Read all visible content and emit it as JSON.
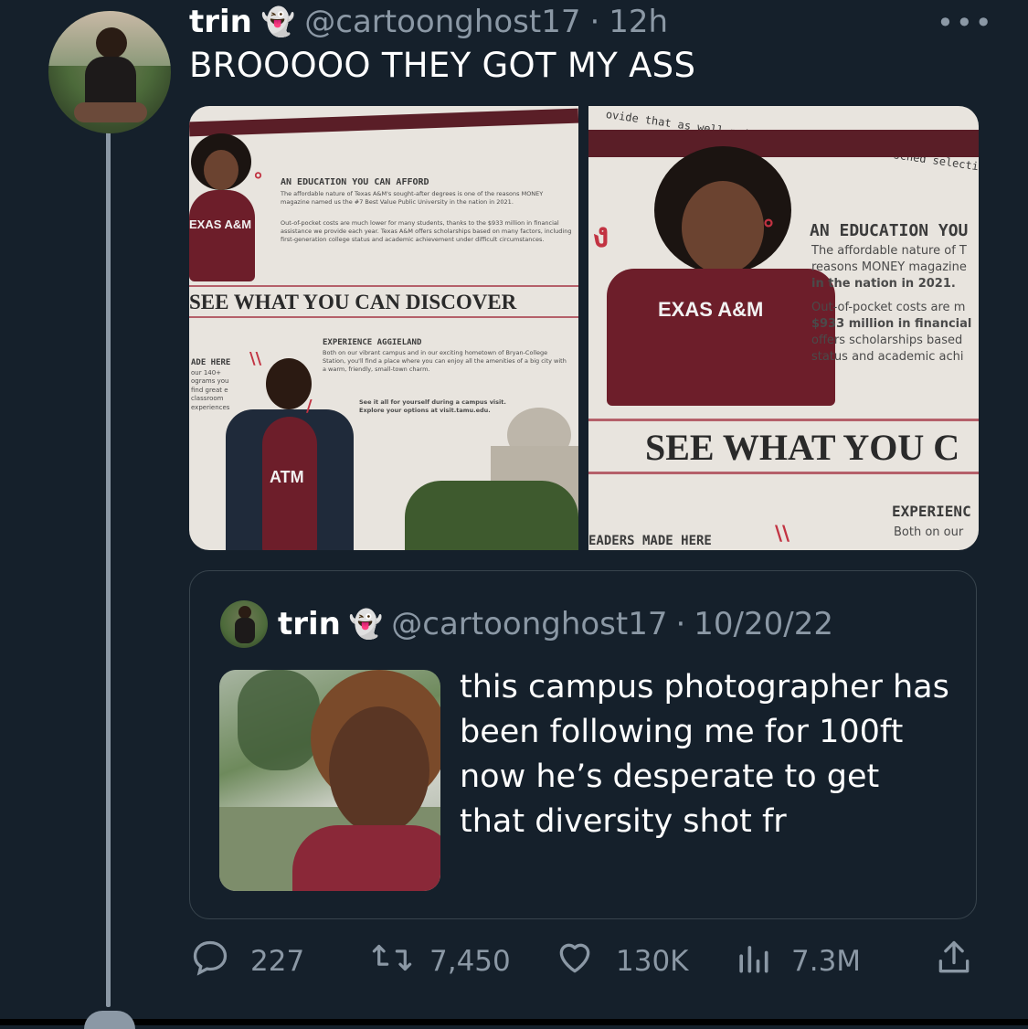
{
  "tweet": {
    "name": "trin",
    "name_emoji": "👻",
    "handle": "@cartoonghost17",
    "separator": "·",
    "time": "12h",
    "text": "BROOOOO THEY GOT MY ASS",
    "more_icon": "more-icon"
  },
  "photos": {
    "left": {
      "heading": "AN EDUCATION YOU CAN AFFORD",
      "body_1": "The affordable nature of Texas A&M's sought-after degrees is one of the reasons MONEY magazine named us the #7 Best Value Public University in the nation in 2021.",
      "body_2": "Out-of-pocket costs are much lower for many students, thanks to the $933 million in financial assistance we provide each year. Texas A&M offers scholarships based on many factors, including first-generation college status and academic achievement under difficult circumstances.",
      "banner": "SEE WHAT YOU CAN DISCOVER",
      "sub_heading": "EXPERIENCE AGGIELAND",
      "sub_body": "Both on our vibrant campus and in our exciting hometown of Bryan-College Station, you'll find a place where you can enjoy all the amenities of a big city with a warm, friendly, small-town charm.",
      "cta": "See it all for yourself during a campus visit. Explore your options at visit.tamu.edu.",
      "side_heading": "ADE HERE",
      "side_body": "our 140+ ograms you find great e classroom experiences",
      "shirt": "EXAS A&M",
      "shirt2": "ATM"
    },
    "right": {
      "heading": "AN EDUCATION YOU CAN",
      "body_1": "The affordable nature of T",
      "body_2": "reasons MONEY magazine",
      "body_3": "in the nation in 2021.",
      "body_4": "Out-of-pocket costs are m",
      "body_5": "$933 million in financial",
      "body_6": "offers scholarships based",
      "body_7": "status and academic achi",
      "banner": "SEE WHAT YOU C",
      "sub_heading": "EXPERIENC",
      "sub_body": "Both on our",
      "bottom": "EADERS MADE HERE",
      "shirt": "EXAS A&M",
      "top_text": "ovide that as well  primary insured, call to sched  selecting the"
    }
  },
  "quoted": {
    "name": "trin",
    "name_emoji": "👻",
    "handle": "@cartoonghost17",
    "separator": "·",
    "date": "10/20/22",
    "text": "this campus photographer has been following me for 100ft now he’s desperate to get that diversity shot fr"
  },
  "actions": {
    "reply_icon": "reply-icon",
    "reply_count": "227",
    "retweet_icon": "retweet-icon",
    "retweet_count": "7,450",
    "like_icon": "heart-icon",
    "like_count": "130K",
    "views_icon": "views-icon",
    "views_count": "7.3M",
    "share_icon": "share-icon"
  },
  "colors": {
    "background": "#15202b",
    "secondary_text": "#8b98a5",
    "border": "#38444d",
    "maroon": "#5a1e27"
  }
}
